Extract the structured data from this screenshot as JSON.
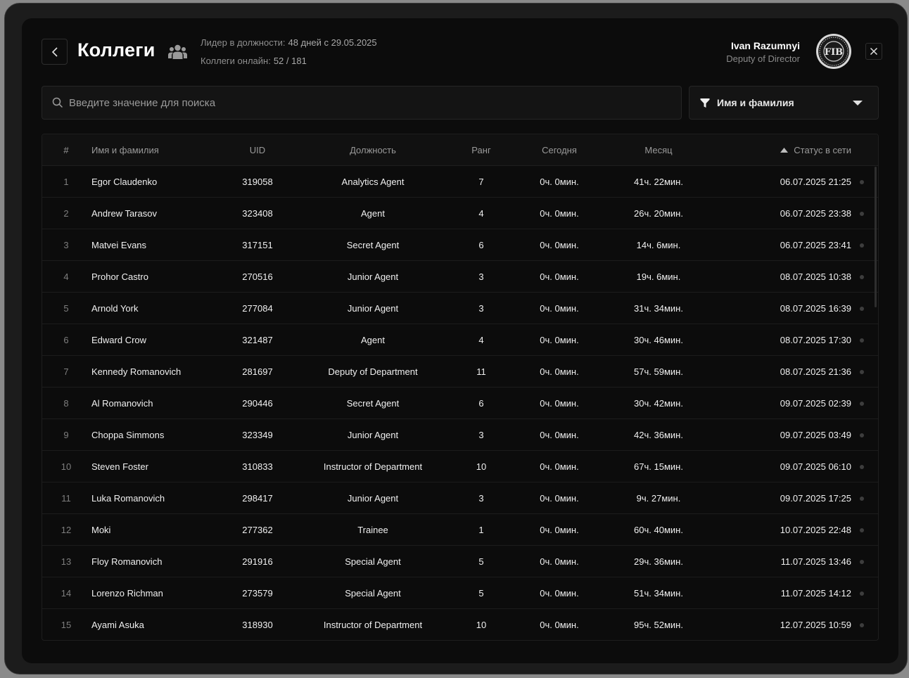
{
  "header": {
    "title": "Коллеги",
    "leader_label": "Лидер в должности:",
    "leader_value": "48 дней  с 29.05.2025",
    "online_label": "Коллеги онлайн:",
    "online_value": "52 / 181",
    "user_name": "Ivan Razumnyi",
    "user_role": "Deputy of Director",
    "avatar_text": "FIB"
  },
  "search": {
    "placeholder": "Введите значение для поиска",
    "value": ""
  },
  "filter": {
    "selected": "Имя и фамилия"
  },
  "table": {
    "columns": {
      "num": "#",
      "name": "Имя и фамилия",
      "uid": "UID",
      "position": "Должность",
      "rank": "Ранг",
      "today": "Сегодня",
      "month": "Месяц",
      "status": "Статус в сети"
    },
    "rows": [
      {
        "num": "1",
        "name": "Egor Claudenko",
        "uid": "319058",
        "position": "Analytics Agent",
        "rank": "7",
        "today": "0ч. 0мин.",
        "month": "41ч. 22мин.",
        "status": "06.07.2025 21:25"
      },
      {
        "num": "2",
        "name": "Andrew Tarasov",
        "uid": "323408",
        "position": "Agent",
        "rank": "4",
        "today": "0ч. 0мин.",
        "month": "26ч. 20мин.",
        "status": "06.07.2025 23:38"
      },
      {
        "num": "3",
        "name": "Matvei Evans",
        "uid": "317151",
        "position": "Secret Agent",
        "rank": "6",
        "today": "0ч. 0мин.",
        "month": "14ч. 6мин.",
        "status": "06.07.2025 23:41"
      },
      {
        "num": "4",
        "name": "Prohor Castro",
        "uid": "270516",
        "position": "Junior Agent",
        "rank": "3",
        "today": "0ч. 0мин.",
        "month": "19ч. 6мин.",
        "status": "08.07.2025 10:38"
      },
      {
        "num": "5",
        "name": "Arnold York",
        "uid": "277084",
        "position": "Junior Agent",
        "rank": "3",
        "today": "0ч. 0мин.",
        "month": "31ч. 34мин.",
        "status": "08.07.2025 16:39"
      },
      {
        "num": "6",
        "name": "Edward Crow",
        "uid": "321487",
        "position": "Agent",
        "rank": "4",
        "today": "0ч. 0мин.",
        "month": "30ч. 46мин.",
        "status": "08.07.2025 17:30"
      },
      {
        "num": "7",
        "name": "Kennedy Romanovich",
        "uid": "281697",
        "position": "Deputy of Department",
        "rank": "11",
        "today": "0ч. 0мин.",
        "month": "57ч. 59мин.",
        "status": "08.07.2025 21:36"
      },
      {
        "num": "8",
        "name": "Al Romanovich",
        "uid": "290446",
        "position": "Secret Agent",
        "rank": "6",
        "today": "0ч. 0мин.",
        "month": "30ч. 42мин.",
        "status": "09.07.2025 02:39"
      },
      {
        "num": "9",
        "name": "Choppa Simmons",
        "uid": "323349",
        "position": "Junior Agent",
        "rank": "3",
        "today": "0ч. 0мин.",
        "month": "42ч. 36мин.",
        "status": "09.07.2025 03:49"
      },
      {
        "num": "10",
        "name": "Steven Foster",
        "uid": "310833",
        "position": "Instructor of Department",
        "rank": "10",
        "today": "0ч. 0мин.",
        "month": "67ч. 15мин.",
        "status": "09.07.2025 06:10"
      },
      {
        "num": "11",
        "name": "Luka Romanovich",
        "uid": "298417",
        "position": "Junior Agent",
        "rank": "3",
        "today": "0ч. 0мин.",
        "month": "9ч. 27мин.",
        "status": "09.07.2025 17:25"
      },
      {
        "num": "12",
        "name": "Moki",
        "uid": "277362",
        "position": "Trainee",
        "rank": "1",
        "today": "0ч. 0мин.",
        "month": "60ч. 40мин.",
        "status": "10.07.2025 22:48"
      },
      {
        "num": "13",
        "name": "Floy Romanovich",
        "uid": "291916",
        "position": "Special Agent",
        "rank": "5",
        "today": "0ч. 0мин.",
        "month": "29ч. 36мин.",
        "status": "11.07.2025 13:46"
      },
      {
        "num": "14",
        "name": "Lorenzo Richman",
        "uid": "273579",
        "position": "Special Agent",
        "rank": "5",
        "today": "0ч. 0мин.",
        "month": "51ч. 34мин.",
        "status": "11.07.2025 14:12"
      },
      {
        "num": "15",
        "name": "Ayami Asuka",
        "uid": "318930",
        "position": "Instructor of Department",
        "rank": "10",
        "today": "0ч. 0мин.",
        "month": "95ч. 52мин.",
        "status": "12.07.2025 10:59"
      }
    ]
  },
  "colors": {
    "panel_bg": "#0c0c0c",
    "frame_bg": "#1c1c1c",
    "text_primary": "#ffffff",
    "text_muted": "#8f8f8f",
    "status_offline": "#3d3d3d"
  }
}
